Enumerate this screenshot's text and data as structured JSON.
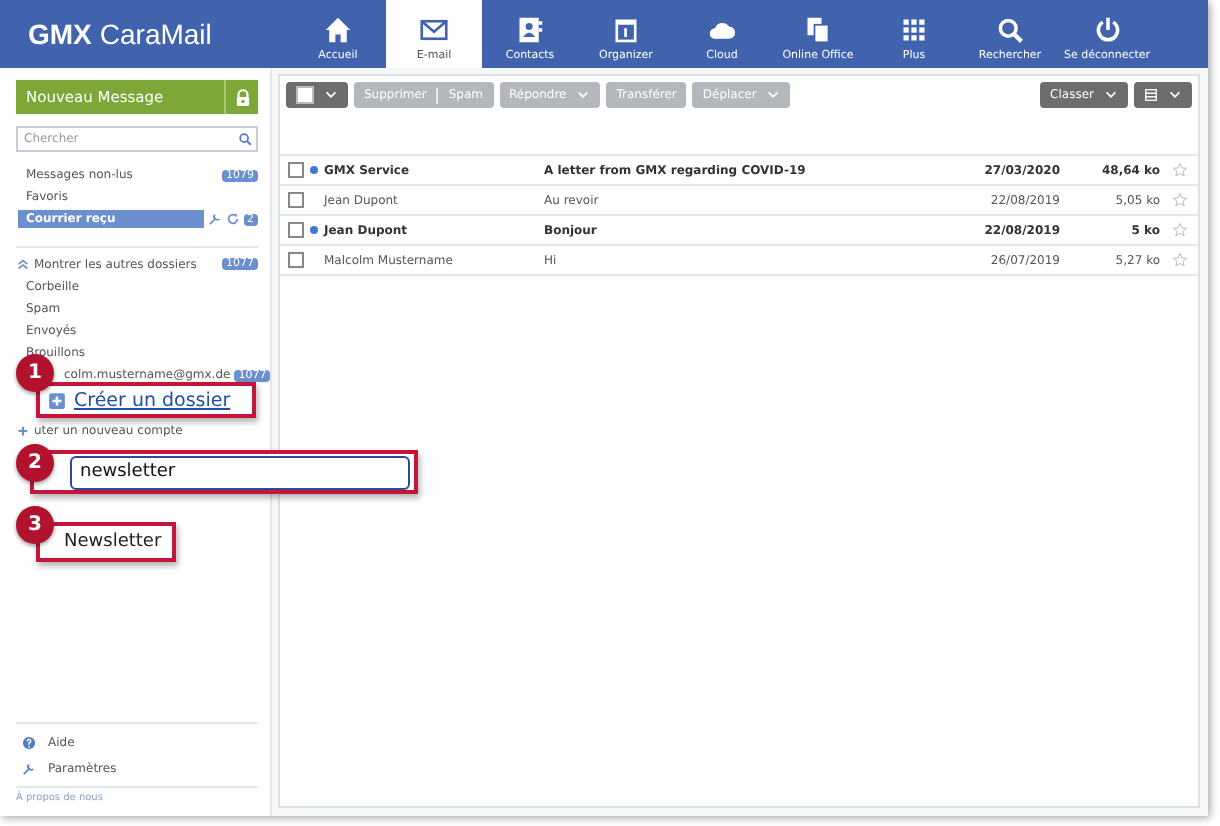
{
  "app": {
    "brand": "GMX",
    "product": "CaraMail"
  },
  "nav": [
    {
      "label": "Accueil",
      "selected": false
    },
    {
      "label": "E-mail",
      "selected": true
    },
    {
      "label": "Contacts",
      "selected": false
    },
    {
      "label": "Organizer",
      "selected": false
    },
    {
      "label": "Cloud",
      "selected": false
    },
    {
      "label": "Online Office",
      "selected": false
    },
    {
      "label": "Plus",
      "selected": false
    },
    {
      "label": "Rechercher",
      "selected": false
    },
    {
      "label": "Se déconnecter",
      "selected": false
    }
  ],
  "sidebar": {
    "compose": "Nouveau Message",
    "search": {
      "placeholder": "Chercher"
    },
    "folders": [
      {
        "kind": "folder",
        "label": "Messages non-lus",
        "count": "1079",
        "selected": false
      },
      {
        "kind": "folder",
        "label": "Favoris",
        "selected": false
      },
      {
        "kind": "inbox",
        "label": "Courrier reçu",
        "count": "2",
        "selected": true
      },
      {
        "kind": "toggle",
        "label": "Montrer les autres dossiers",
        "count": "1077",
        "selected": false
      },
      {
        "kind": "folder",
        "label": "Corbeille",
        "selected": false
      },
      {
        "kind": "folder",
        "label": "Spam",
        "selected": false
      },
      {
        "kind": "folder",
        "label": "Envoyés",
        "selected": false
      },
      {
        "kind": "folder",
        "label": "Brouillons",
        "selected": false
      },
      {
        "kind": "account",
        "label": "colm.mustername@gmx.de",
        "count": "1077",
        "selected": false
      },
      {
        "kind": "add",
        "label": "uter un nouveau compte",
        "selected": false
      }
    ],
    "footer": [
      {
        "kind": "help",
        "label": "Aide"
      },
      {
        "kind": "settings",
        "label": "Paramètres"
      },
      {
        "kind": "about",
        "label": "À propos de nous"
      }
    ]
  },
  "toolbar": {
    "left": [
      {
        "kind": "select",
        "checked": false,
        "disabled": false
      },
      {
        "kind": "split",
        "labels": [
          "Supprimer",
          "Spam"
        ],
        "disabled": true
      },
      {
        "kind": "menu",
        "labels": [
          "Répondre"
        ],
        "disabled": true
      },
      {
        "kind": "plain",
        "labels": [
          "Transférer"
        ],
        "disabled": true
      },
      {
        "kind": "menu",
        "labels": [
          "Déplacer"
        ],
        "disabled": true
      }
    ],
    "right": [
      {
        "kind": "menu",
        "labels": [
          "Classer"
        ],
        "disabled": false
      },
      {
        "kind": "view",
        "disabled": false
      }
    ]
  },
  "messages": [
    {
      "sender": "GMX Service",
      "subject": "A letter from GMX regarding COVID-19",
      "date": "27/03/2020",
      "size": "48,64 ko",
      "unread": true,
      "checked": false
    },
    {
      "sender": "Jean Dupont",
      "subject": "Au revoir",
      "date": "22/08/2019",
      "size": "5,05 ko",
      "unread": false,
      "checked": false
    },
    {
      "sender": "Jean Dupont",
      "subject": "Bonjour",
      "date": "22/08/2019",
      "size": "5 ko",
      "unread": true,
      "checked": false
    },
    {
      "sender": "Malcolm Mustername",
      "subject": "Hi",
      "date": "26/07/2019",
      "size": "5,27 ko",
      "unread": false,
      "checked": false
    }
  ],
  "callouts": [
    {
      "number": "1",
      "kind": "link",
      "text": "Créer un dossier"
    },
    {
      "number": "2",
      "kind": "input",
      "text": "newsletter"
    },
    {
      "number": "3",
      "kind": "label",
      "text": "Newsletter"
    }
  ]
}
